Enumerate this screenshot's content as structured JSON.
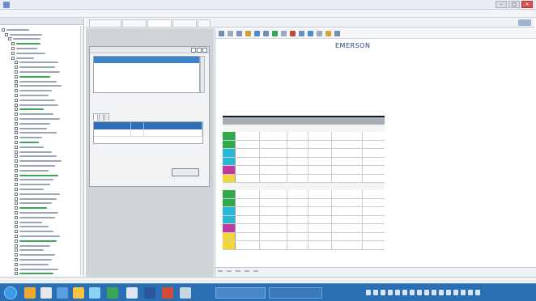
{
  "window": {
    "title": "",
    "controls": [
      "–",
      "□",
      "✕"
    ]
  },
  "menubar": {
    "items": [
      "",
      "",
      "",
      "",
      ""
    ]
  },
  "left_panel": {
    "header": ""
  },
  "tabs": {
    "items": [
      "",
      "",
      "",
      "",
      ""
    ]
  },
  "dialog": {
    "title": "",
    "reports": [
      "",
      "",
      ""
    ],
    "subtabs": [
      "",
      "",
      ""
    ],
    "param_headers": [
      "",
      "",
      ""
    ],
    "param_rows": [
      [
        "",
        "",
        ""
      ]
    ],
    "run_label": ""
  },
  "viewer": {
    "zoom": "",
    "page": "",
    "logo": "EMERSON",
    "report_title": "",
    "columns": [
      "",
      "",
      "",
      "",
      ""
    ],
    "group_label": "",
    "bottom_tabs": [
      "",
      "",
      "",
      "",
      ""
    ]
  },
  "colors": {
    "selection": "#3e83c9",
    "grid_header": "#2f6db5",
    "taskbar": "#2a6fb4",
    "swatch_green": "#2eaa4a",
    "swatch_cyan": "#29b7d6",
    "swatch_magenta": "#c23aa0",
    "swatch_yellow": "#f2d637"
  },
  "taskbar": {
    "window_1": "",
    "window_2": "",
    "clock_time": "",
    "clock_date": ""
  },
  "statusbar": {
    "text": ""
  }
}
